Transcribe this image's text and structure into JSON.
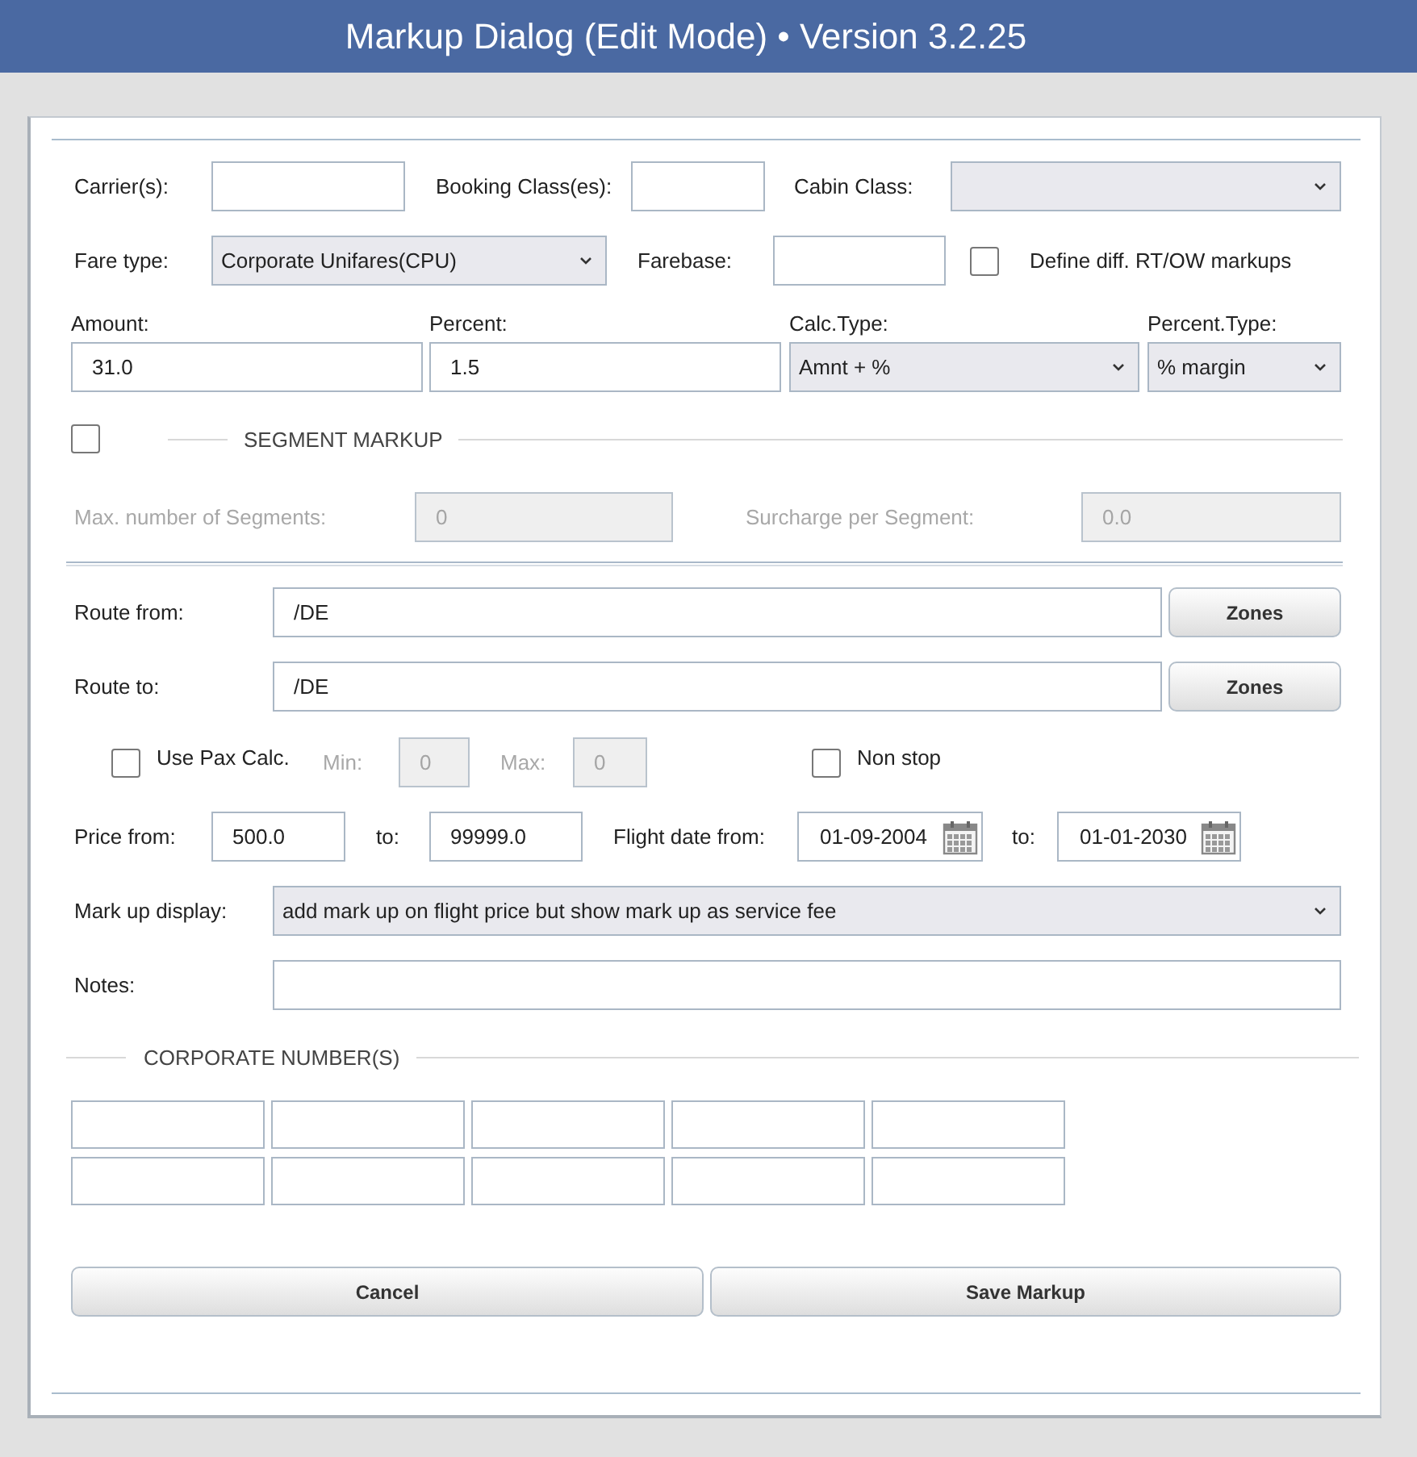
{
  "window": {
    "title": "Markup Dialog (Edit Mode) • Version 3.2.25"
  },
  "carriers": {
    "label": "Carrier(s):"
  },
  "booking_classes": {
    "label": "Booking Class(es):"
  },
  "cabin_class": {
    "label": "Cabin Class:"
  },
  "fare_type": {
    "label": "Fare type:",
    "value": "Corporate Unifares(CPU)"
  },
  "farebase": {
    "label": "Farebase:"
  },
  "define_diff": {
    "label": "Define diff. RT/OW markups",
    "checked": false
  },
  "amount": {
    "label": "Amount:",
    "value": "31.0"
  },
  "percent": {
    "label": "Percent:",
    "value": "1.5"
  },
  "calc_type": {
    "label": "Calc.Type:",
    "value": "Amnt + %"
  },
  "percent_type": {
    "label": "Percent.Type:",
    "value": "% margin"
  },
  "segment_markup": {
    "title": "SEGMENT MARKUP",
    "checked": false,
    "max_segments": {
      "label": "Max. number of Segments:",
      "value": "0",
      "disabled": true
    },
    "surcharge": {
      "label": "Surcharge per Segment:",
      "value": "0.0",
      "disabled": true
    }
  },
  "route_from": {
    "label": "Route from:",
    "value": "/DE",
    "button": "Zones"
  },
  "route_to": {
    "label": "Route to:",
    "value": "/DE",
    "button": "Zones"
  },
  "use_pax_calc": {
    "label": "Use Pax Calc.",
    "checked": false,
    "min": {
      "label": "Min:",
      "value": "0",
      "disabled": true
    },
    "max": {
      "label": "Max:",
      "value": "0",
      "disabled": true
    }
  },
  "non_stop": {
    "label": "Non stop",
    "checked": false
  },
  "price_from": {
    "label": "Price from:",
    "value": "500.0"
  },
  "price_to": {
    "label": "to:",
    "value": "99999.0"
  },
  "flight_date_from": {
    "label": "Flight date from:",
    "value": "01-09-2004"
  },
  "flight_date_to": {
    "label": "to:",
    "value": "01-01-2030"
  },
  "markup_display": {
    "label": "Mark up display:",
    "value": "add mark up on flight price but show mark up as service fee"
  },
  "notes": {
    "label": "Notes:"
  },
  "corporate_numbers": {
    "title": "CORPORATE NUMBER(S)"
  },
  "buttons": [
    "Cancel",
    "Save Markup"
  ]
}
